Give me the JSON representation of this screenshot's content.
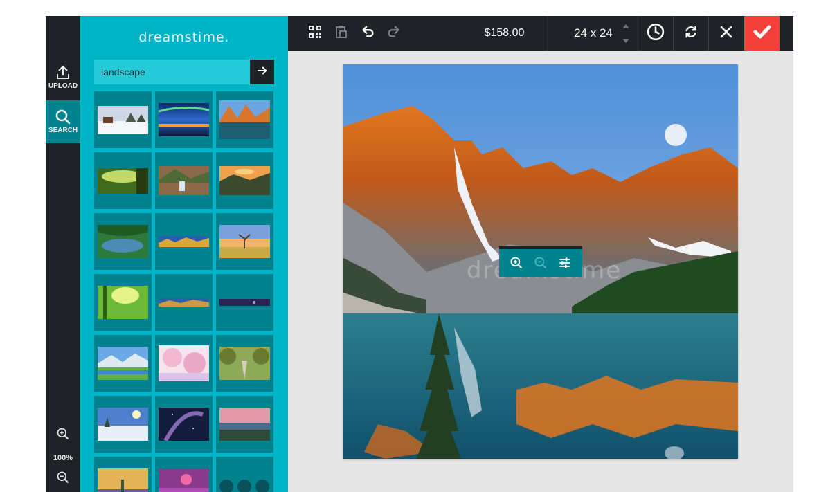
{
  "brand": {
    "logo_text": "dreamstime."
  },
  "rail": {
    "upload_label": "UPLOAD",
    "search_label": "SEARCH",
    "zoom_level": "100%"
  },
  "search": {
    "query": "landscape",
    "result_count_visible": 21
  },
  "toolbar": {
    "price": "$158.00",
    "size": "24 x 24"
  },
  "canvas": {
    "watermark": "dreamstime"
  },
  "colors": {
    "panel": "#00b4c8",
    "tile": "#00838f",
    "dark": "#1f2327",
    "confirm": "#f2413a"
  },
  "icons": [
    "upload-icon",
    "search-icon",
    "zoom-in-icon",
    "zoom-out-icon",
    "qr-code-icon",
    "paste-icon",
    "undo-icon",
    "redo-icon",
    "history-icon",
    "refresh-icon",
    "close-icon",
    "check-icon",
    "arrow-right-icon",
    "adjust-icon"
  ]
}
